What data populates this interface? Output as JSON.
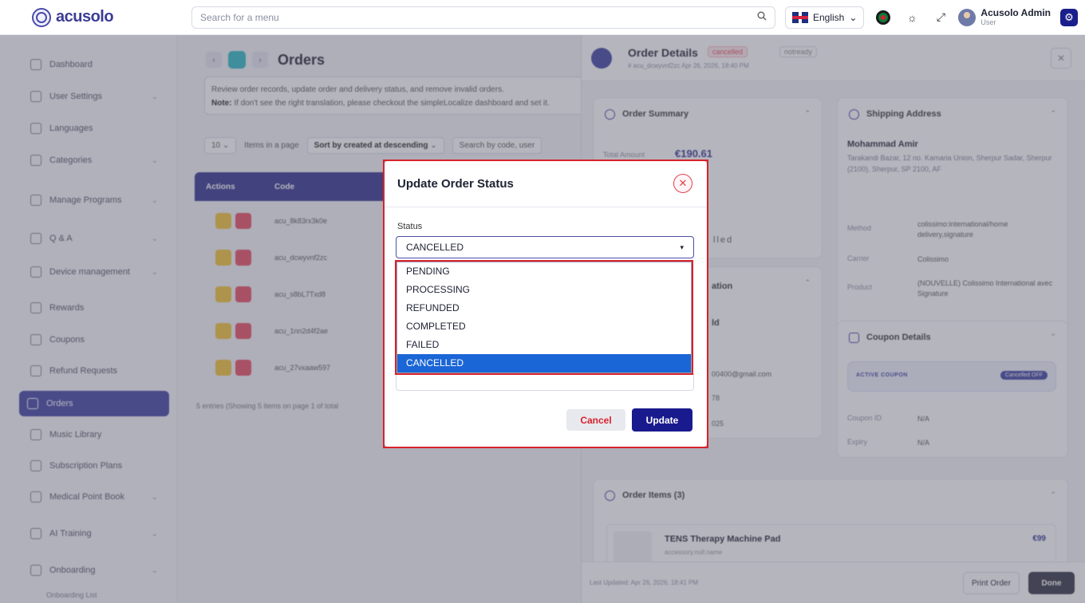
{
  "topbar": {
    "brand": "acusolo",
    "search_placeholder": "Search for a menu",
    "language": "English",
    "user_name": "Acusolo Admin",
    "user_role": "User"
  },
  "sidebar": {
    "items": [
      {
        "label": "Dashboard",
        "icon": "grid-icon"
      },
      {
        "label": "User Settings",
        "icon": "users-icon"
      },
      {
        "label": "Languages",
        "icon": "globe-icon"
      },
      {
        "label": "Categories",
        "icon": "tag-icon"
      },
      {
        "label": "Manage Programs",
        "icon": "programs-icon"
      },
      {
        "label": "Q & A",
        "icon": "question-icon"
      },
      {
        "label": "Device management",
        "icon": "device-icon"
      },
      {
        "label": "Rewards",
        "icon": "trophy-icon"
      },
      {
        "label": "Coupons",
        "icon": "coupon-icon"
      },
      {
        "label": "Refund Requests",
        "icon": "refund-icon"
      },
      {
        "label": "Orders",
        "icon": "orders-icon"
      },
      {
        "label": "Music Library",
        "icon": "music-icon"
      },
      {
        "label": "Subscription Plans",
        "icon": "subscription-icon"
      },
      {
        "label": "Medical Point Book",
        "icon": "heart-icon"
      },
      {
        "label": "AI Training",
        "icon": "ai-icon"
      },
      {
        "label": "Onboarding",
        "icon": "onboarding-icon"
      }
    ],
    "sub_item": "Onboarding List"
  },
  "main": {
    "title": "Orders",
    "description": "Review order records, update order and delivery status, and remove invalid orders.",
    "note_label": "Note:",
    "note": "If don't see the right translation, please checkout the simpleLocalize dashboard and set it.",
    "page_size": "10",
    "page_size_label": "Items in a page",
    "sort": "Sort by created at descending",
    "search_placeholder": "Search by code, user",
    "columns": [
      "Actions",
      "Code"
    ],
    "codes": [
      "acu_8k83rx3k0e",
      "acu_dcwyvnf2zc",
      "acu_s8bL7Txd8",
      "acu_1nn2d4f2ae",
      "acu_27vxaaw597"
    ],
    "entries": "5 entries (Showing 5 items on page 1 of total"
  },
  "drawer": {
    "title": "Order Details",
    "badge_status": "cancelled",
    "badge_ready": "notready",
    "subtitle": "# acu_dcwyvnf2zc  Apr 26, 2026, 18:40 PM",
    "order_summary": "Order Summary",
    "total_label": "Total Amount",
    "total_value": "€190.61",
    "status_fragment": "lled",
    "info_title_fragment": "ation",
    "name_fragment": "ld",
    "email_fragment": "00400@gmail.com",
    "phone_fragment": "78",
    "year_fragment": "025",
    "shipping_title": "Shipping Address",
    "ship_name": "Mohammad Amir",
    "ship_address": "Tarakandi Bazar, 12 no. Kamaria Union, Sherpur Sadar, Sherpur (2100), Sherpur, SP 2100, AF",
    "method_label": "Method",
    "method_value": "colissimo:international/home delivery,signature",
    "carrier_label": "Carrier",
    "carrier_value": "Colissimo",
    "product_label": "Product",
    "product_value": "(NOUVELLE) Colissimo International avec Signature",
    "coupon_title": "Coupon Details",
    "coupon_label": "ACTIVE COUPON",
    "coupon_pill": "Cancelled OFF",
    "coupon_id_label": "Coupon ID",
    "coupon_id_value": "N/A",
    "expiry_label": "Expiry",
    "expiry_value": "N/A",
    "items_title": "Order Items (3)",
    "item_name": "TENS Therapy Machine Pad",
    "item_sub": "accessory.null.name",
    "item_price": "€99",
    "footer_text": "Last Updated: Apr 26, 2026, 18:41 PM",
    "print_label": "Print Order",
    "done_label": "Done"
  },
  "modal": {
    "title": "Update Order Status",
    "status_label": "Status",
    "selected": "CANCELLED",
    "options": [
      "PENDING",
      "PROCESSING",
      "REFUNDED",
      "COMPLETED",
      "FAILED",
      "CANCELLED"
    ],
    "cancel_label": "Cancel",
    "update_label": "Update"
  },
  "colors": {
    "primary": "#1a1a8f",
    "highlight_red": "#d8222c",
    "selected_option": "#1b66d6"
  }
}
